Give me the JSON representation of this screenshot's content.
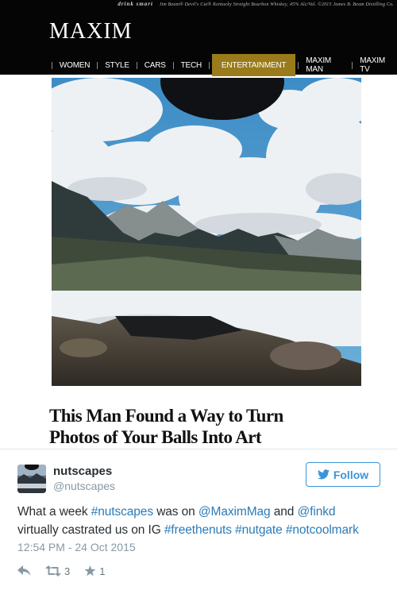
{
  "article": {
    "promo_brand": "drink  smart",
    "promo_text": "Jim Beam® Devil's Cut® Kentucky Straight Bourbon Whiskey, 45% Alc/Vol. ©2015 James B. Beam Distilling Co.",
    "logo": "MAXIM",
    "nav": [
      "WOMEN",
      "STYLE",
      "CARS",
      "TECH",
      "ENTERTAINMENT",
      "MAXIM MAN",
      "MAXIM TV"
    ],
    "active_nav": "ENTERTAINMENT",
    "headline_line1": "This Man Found a Way to Turn",
    "headline_line2": "Photos of Your Balls Into Art"
  },
  "tweet": {
    "name": "nutscapes",
    "handle": "@nutscapes",
    "follow_label": "Follow",
    "text": {
      "t1": "What a week ",
      "l1": "#nutscapes",
      "t2": " was on ",
      "l2": "@MaximMag",
      "t3": " and ",
      "l3": "@finkd",
      "t4": "virtually castrated us on IG ",
      "l4": "#freethenuts",
      "t5": " ",
      "l5": "#nutgate",
      "t6": " ",
      "l6": "#notcoolmark"
    },
    "timestamp": "12:54 PM - 24 Oct 2015",
    "retweets": "3",
    "likes": "1"
  },
  "colors": {
    "link": "#2b7bb9",
    "follow": "#3b94d9",
    "nav_active": "#9a7b1b"
  }
}
